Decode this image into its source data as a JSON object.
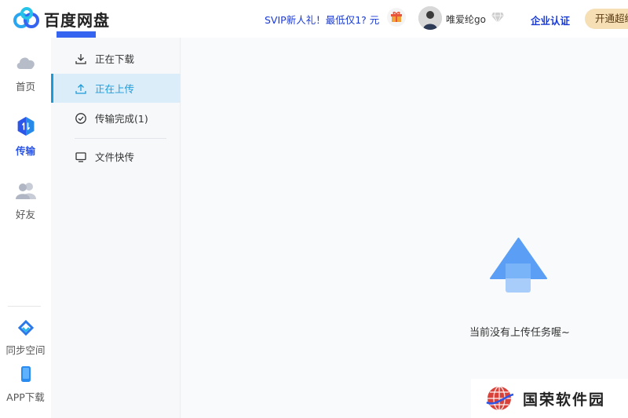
{
  "app": {
    "name": "百度网盘"
  },
  "header": {
    "promo": "SVIP新人礼！最低仅1? 元",
    "username": "唯爱纶go",
    "enterprise": "企业认证",
    "open_vip": "开通超级"
  },
  "leftnav": {
    "items": [
      {
        "label": "首页",
        "icon": "cloud-icon"
      },
      {
        "label": "传输",
        "icon": "transfer-icon"
      },
      {
        "label": "好友",
        "icon": "friends-icon"
      },
      {
        "label": "同步空间",
        "icon": "sync-icon"
      },
      {
        "label": "APP下载",
        "icon": "phone-icon"
      }
    ],
    "active_index": 1
  },
  "subnav": {
    "items": [
      {
        "label": "正在下载",
        "icon": "download-icon"
      },
      {
        "label": "正在上传",
        "icon": "upload-icon"
      },
      {
        "label": "传输完成(1)",
        "icon": "check-circle-icon"
      },
      {
        "label": "文件快传",
        "icon": "monitor-icon"
      }
    ],
    "active_index": 1
  },
  "main": {
    "empty_message": "当前没有上传任务喔~"
  },
  "watermark": {
    "text": "国荣软件园"
  },
  "colors": {
    "brand_blue": "#2b56e8",
    "active_cyan": "#1d9bd8",
    "vip_gold": "#f6dfb5"
  }
}
